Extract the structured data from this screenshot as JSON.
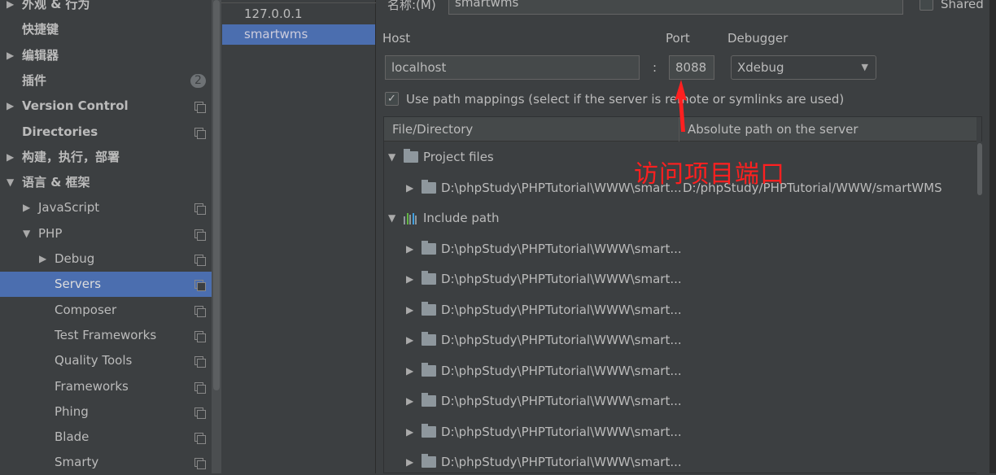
{
  "sidebar": {
    "items": [
      {
        "label": "外观 & 行为",
        "level": 0,
        "arrow": "right",
        "bold": true
      },
      {
        "label": "快捷键",
        "level": 0,
        "bold": true
      },
      {
        "label": "编辑器",
        "level": 0,
        "arrow": "right",
        "bold": true
      },
      {
        "label": "插件",
        "level": 0,
        "bold": true,
        "badge": "2"
      },
      {
        "label": "Version Control",
        "level": 0,
        "arrow": "right",
        "bold": true,
        "copy": true
      },
      {
        "label": "Directories",
        "level": 0,
        "bold": true,
        "copy": true
      },
      {
        "label": "构建，执行，部署",
        "level": 0,
        "arrow": "right",
        "bold": true
      },
      {
        "label": "语言 & 框架",
        "level": 0,
        "arrow": "down",
        "bold": true
      },
      {
        "label": "JavaScript",
        "level": 1,
        "arrow": "right",
        "copy": true
      },
      {
        "label": "PHP",
        "level": 1,
        "arrow": "down",
        "copy": true
      },
      {
        "label": "Debug",
        "level": 2,
        "arrow": "right",
        "copy": true
      },
      {
        "label": "Servers",
        "level": 2,
        "copy": true,
        "selected": true
      },
      {
        "label": "Composer",
        "level": 2,
        "copy": true
      },
      {
        "label": "Test Frameworks",
        "level": 2,
        "copy": true
      },
      {
        "label": "Quality Tools",
        "level": 2,
        "copy": true
      },
      {
        "label": "Frameworks",
        "level": 2,
        "copy": true
      },
      {
        "label": "Phing",
        "level": 2,
        "copy": true
      },
      {
        "label": "Blade",
        "level": 2,
        "copy": true
      },
      {
        "label": "Smarty",
        "level": 2,
        "copy": true
      }
    ]
  },
  "servers": {
    "items": [
      {
        "label": "127.0.0.1"
      },
      {
        "label": "smartwms",
        "selected": true
      }
    ]
  },
  "form": {
    "name_label": "名称:(M)",
    "name_value": "smartwms",
    "shared_label": "Shared",
    "shared_checked": false,
    "host_label": "Host",
    "host_value": "localhost",
    "colon": ":",
    "port_label": "Port",
    "port_value": "8088",
    "debugger_label": "Debugger",
    "debugger_value": "Xdebug",
    "path_mappings_label": "Use path mappings (select if the server is remote or symlinks are used)",
    "path_mappings_checked": true
  },
  "table": {
    "headers": [
      "File/Directory",
      "Absolute path on the server"
    ],
    "rows": [
      {
        "level": 0,
        "arrow": "down",
        "icon": "folder-icon",
        "label": "Project files"
      },
      {
        "level": 1,
        "arrow": "right",
        "icon": "folder-icon",
        "label": "D:\\phpStudy\\PHPTutorial\\WWW\\smart...",
        "server": "D:/phpStudy/PHPTutorial/WWW/smartWMS"
      },
      {
        "level": 0,
        "arrow": "down",
        "icon": "library-icon",
        "label": "Include path"
      },
      {
        "level": 1,
        "arrow": "right",
        "icon": "folder-icon",
        "label": "D:\\phpStudy\\PHPTutorial\\WWW\\smart..."
      },
      {
        "level": 1,
        "arrow": "right",
        "icon": "folder-icon",
        "label": "D:\\phpStudy\\PHPTutorial\\WWW\\smart..."
      },
      {
        "level": 1,
        "arrow": "right",
        "icon": "folder-icon",
        "label": "D:\\phpStudy\\PHPTutorial\\WWW\\smart..."
      },
      {
        "level": 1,
        "arrow": "right",
        "icon": "folder-icon",
        "label": "D:\\phpStudy\\PHPTutorial\\WWW\\smart..."
      },
      {
        "level": 1,
        "arrow": "right",
        "icon": "folder-icon",
        "label": "D:\\phpStudy\\PHPTutorial\\WWW\\smart..."
      },
      {
        "level": 1,
        "arrow": "right",
        "icon": "folder-icon",
        "label": "D:\\phpStudy\\PHPTutorial\\WWW\\smart..."
      },
      {
        "level": 1,
        "arrow": "right",
        "icon": "folder-icon",
        "label": "D:\\phpStudy\\PHPTutorial\\WWW\\smart..."
      },
      {
        "level": 1,
        "arrow": "right",
        "icon": "folder-icon",
        "label": "D:\\phpStudy\\PHPTutorial\\WWW\\smart..."
      }
    ]
  },
  "annotation": {
    "text": "访问项目端口",
    "color": "#ff2020"
  },
  "colors": {
    "selection": "#4b6eaf",
    "background": "#3c3f41"
  }
}
